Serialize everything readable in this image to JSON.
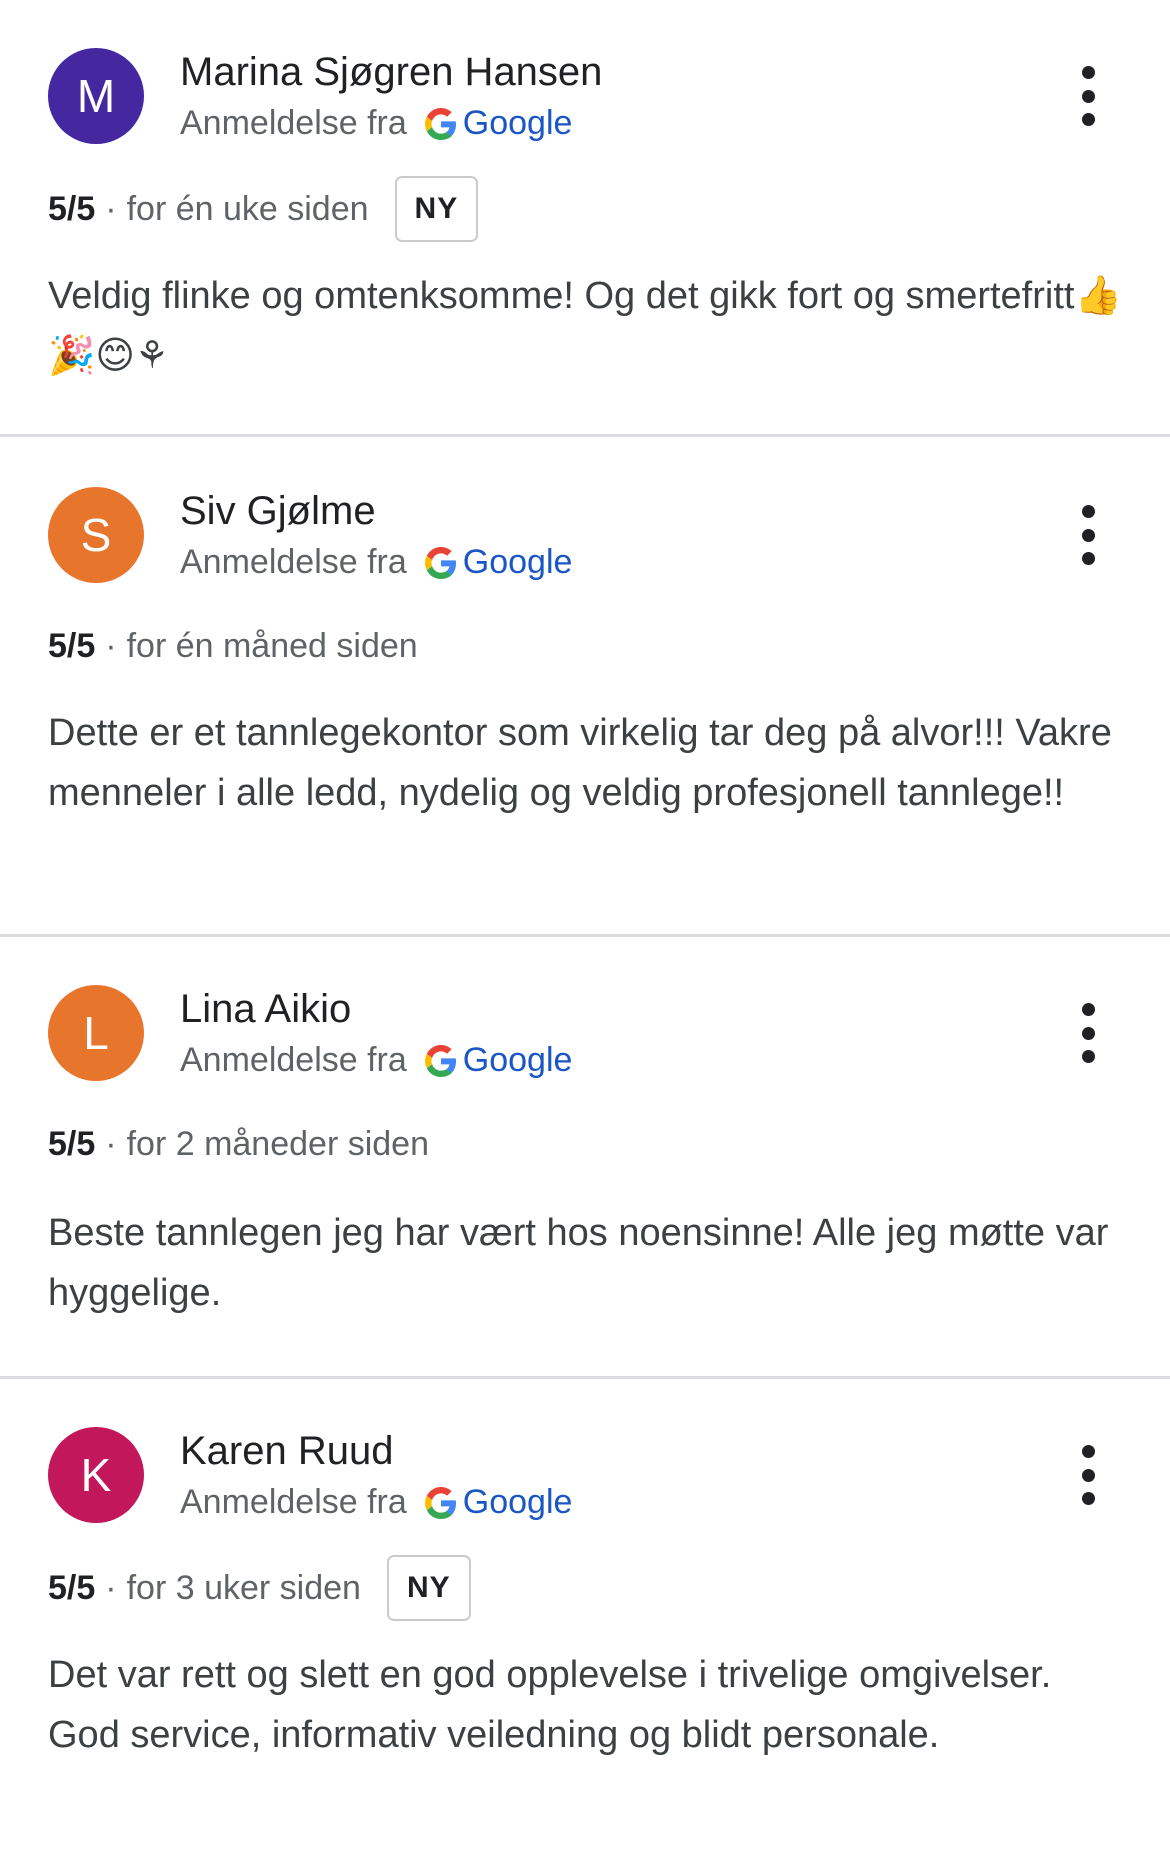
{
  "reviews": [
    {
      "initial": "M",
      "avatar_color": "#4527a0",
      "name": "Marina Sjøgren Hansen",
      "source_prefix": "Anmeldelse fra",
      "source_name": "Google",
      "rating": "5/5",
      "separator": "·",
      "time": "for én uke siden",
      "badge": "NY",
      "text": "Veldig flinke og omtenksomme! Og det gikk fort og smertefritt👍🎉😊⚘"
    },
    {
      "initial": "S",
      "avatar_color": "#e8752c",
      "name": "Siv Gjølme",
      "source_prefix": "Anmeldelse fra",
      "source_name": "Google",
      "rating": "5/5",
      "separator": "·",
      "time": "for én måned siden",
      "badge": "",
      "text": "Dette er et tannlegekontor som virkelig tar deg på alvor!!! Vakre menneler i alle ledd, nydelig og veldig profesjonell tannlege!!"
    },
    {
      "initial": "L",
      "avatar_color": "#e8752c",
      "name": "Lina Aikio",
      "source_prefix": "Anmeldelse fra",
      "source_name": "Google",
      "rating": "5/5",
      "separator": "·",
      "time": "for 2 måneder siden",
      "badge": "",
      "text": "Beste tannlegen jeg har vært hos noensinne! Alle jeg møtte var hyggelige."
    },
    {
      "initial": "K",
      "avatar_color": "#c2185b",
      "name": "Karen Ruud",
      "source_prefix": "Anmeldelse fra",
      "source_name": "Google",
      "rating": "5/5",
      "separator": "·",
      "time": "for 3 uker siden",
      "badge": "NY",
      "text": "Det var rett og slett en god opplevelse i trivelige omgivelser. God service, informativ veiledning og blidt personale."
    }
  ],
  "icons": {
    "google": "google-g-icon",
    "more": "more-vert-icon"
  }
}
